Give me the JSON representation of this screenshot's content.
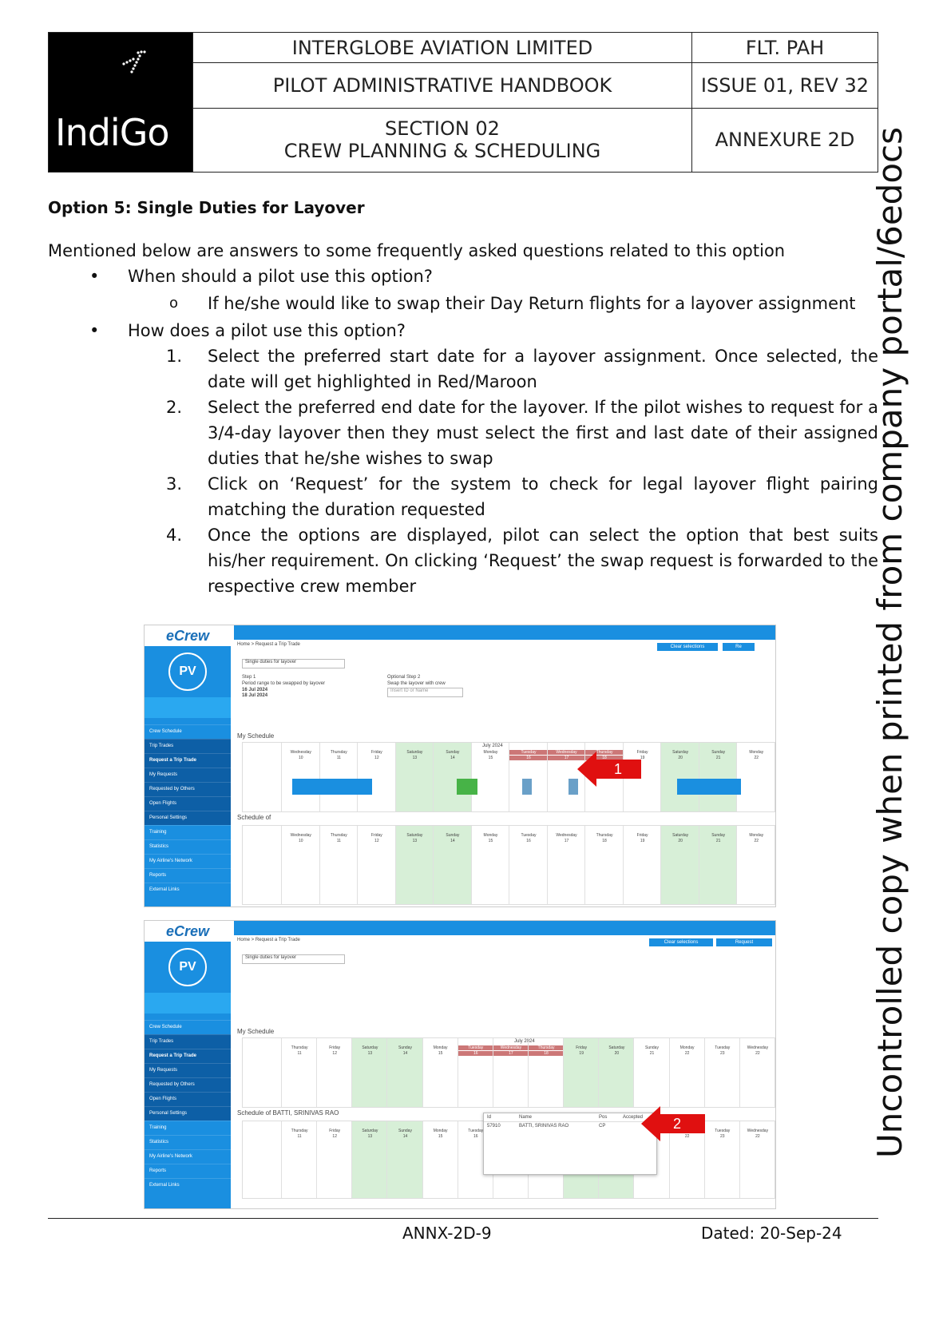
{
  "header": {
    "company": "INTERGLOBE AVIATION LIMITED",
    "doc_code": "FLT. PAH",
    "handbook": "PILOT ADMINISTRATIVE HANDBOOK",
    "issue": "ISSUE 01, REV 32",
    "section": "SECTION 02",
    "section_title": "CREW PLANNING & SCHEDULING",
    "annexure": "ANNEXURE 2D",
    "logo_text": "IndiGo"
  },
  "side_note": "Uncontrolled copy when printed from company portal/6edocs",
  "body": {
    "heading": "Option 5: Single Duties for Layover",
    "intro": "Mentioned below are answers to some frequently asked questions related to this option",
    "q1": "When should a pilot use this option?",
    "a1": "If he/she would like to swap their Day Return flights for a layover assignment",
    "q2": "How does a pilot use this option?",
    "steps": [
      {
        "n": "1.",
        "text": "Select the preferred start date for a layover assignment. Once selected, the date will get highlighted in Red/Maroon"
      },
      {
        "n": "2.",
        "text": "Select the preferred end date for the layover. If the pilot wishes to request for a 3/4-day layover then they must select the first and last date of their assigned duties that he/she wishes to swap"
      },
      {
        "n": "3.",
        "text": "Click on ‘Request’ for the system to check for legal layover flight pairing matching the duration requested"
      },
      {
        "n": "4.",
        "text": "Once the options are displayed, pilot can select the option that best suits his/her requirement. On clicking ‘Request’ the swap request is forwarded to the respective crew member"
      }
    ]
  },
  "screens": [
    {
      "brand": "eCrew",
      "avatar": "PV",
      "breadcrumb": "Home  >  Request a Trip Trade",
      "clear": "Clear selections",
      "request": "Re",
      "dropdown": "Single duties for layover",
      "step1": "Step 1",
      "step1_desc": "Period range to be swapped by layover",
      "dates": "16 Jul 2024\n18 Jul 2024",
      "step2": "Optional Step 2",
      "step2_desc": "Swap the layover with crew",
      "input_ph": "Insert ID or Name",
      "my_schedule": "My Schedule",
      "schedule_of": "Schedule of",
      "month": "July 2024",
      "days": [
        "Wednesday",
        "Thursday",
        "Friday",
        "Saturday",
        "Sunday",
        "Monday",
        "Tuesday",
        "Wednesday",
        "Thursday",
        "Friday",
        "Saturday",
        "Sunday",
        "Monday"
      ],
      "nums": [
        "10",
        "11",
        "12",
        "13",
        "14",
        "15",
        "16",
        "17",
        "18",
        "19",
        "20",
        "21",
        "22"
      ],
      "marker": "1"
    },
    {
      "brand": "eCrew",
      "avatar": "PV",
      "breadcrumb": "Home  >  Request a Trip Trade",
      "clear": "Clear selections",
      "request": "Request",
      "dropdown": "Single duties for layover",
      "my_schedule": "My Schedule",
      "schedule_of": "Schedule of",
      "crew_name": "BATTI, SRINIVAS RAO",
      "month": "July 2024",
      "days": [
        "Thursday",
        "Friday",
        "Saturday",
        "Sunday",
        "Monday",
        "Tuesday",
        "Wednesday",
        "Thursday",
        "Friday",
        "Saturday",
        "Sunday",
        "Monday",
        "Tuesday",
        "Wednesday"
      ],
      "nums": [
        "11",
        "12",
        "13",
        "14",
        "15",
        "16",
        "17",
        "18",
        "19",
        "20",
        "21",
        "22",
        "23",
        "22"
      ],
      "popup_cols": [
        "Id",
        "Name",
        "Pos",
        "Accepted"
      ],
      "popup_row": [
        "57910",
        "BATTI, SRINIVAS RAO",
        "CP",
        ""
      ],
      "marker": "2"
    }
  ],
  "sidebar_items": [
    "Crew Schedule",
    "Trip Trades",
    "Request a Trip Trade",
    "My Requests",
    "Requested by Others",
    "Open Flights",
    "Personal Settings",
    "Training",
    "Statistics",
    "My Airline's Network",
    "Reports",
    "External Links"
  ],
  "footer": {
    "page": "ANNX-2D-9",
    "date": "Dated: 20-Sep-24"
  }
}
